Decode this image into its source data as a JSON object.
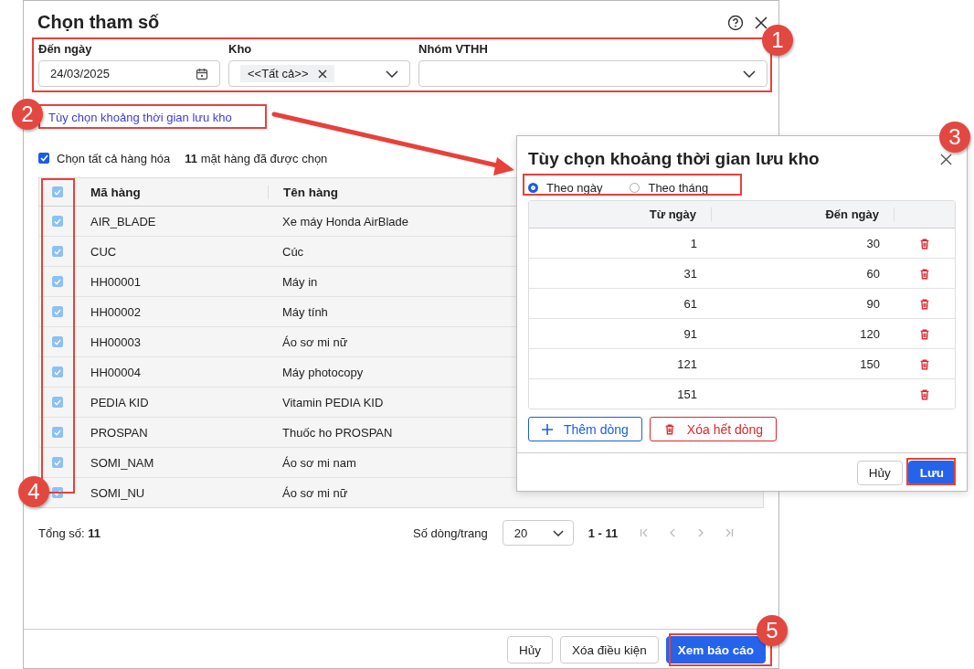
{
  "window": {
    "title": "Chọn tham số"
  },
  "filters": [
    {
      "kind": "date",
      "label": "Đến ngày",
      "value": "24/03/2025"
    },
    {
      "kind": "multiselect",
      "label": "Kho",
      "tag": "<<Tất cả>>"
    },
    {
      "kind": "select",
      "label": "Nhóm VTHH"
    }
  ],
  "range_link": "Tùy chọn khoảng thời gian lưu kho",
  "select_all": {
    "label": "Chọn tất cả hàng hóa",
    "checked": true,
    "summary": "**11** mặt hàng đã được chọn"
  },
  "table": {
    "header_checked": true,
    "columns": [
      "Mã hàng",
      "Tên hàng"
    ],
    "rows": [
      {
        "code": "AIR_BLADE",
        "name": "Xe máy Honda AirBlade",
        "checked": true
      },
      {
        "code": "CUC",
        "name": "Cúc",
        "checked": true
      },
      {
        "code": "HH00001",
        "name": "Máy in",
        "checked": true
      },
      {
        "code": "HH00002",
        "name": "Máy tính",
        "checked": true
      },
      {
        "code": "HH00003",
        "name": "Áo sơ mi nữ",
        "checked": true
      },
      {
        "code": "HH00004",
        "name": "Máy photocopy",
        "checked": true
      },
      {
        "code": "PEDIA KID",
        "name": "Vitamin PEDIA KID",
        "checked": true
      },
      {
        "code": "PROSPAN",
        "name": "Thuốc ho PROSPAN",
        "checked": true
      },
      {
        "code": "SOMI_NAM",
        "name": "Áo sơ mi nam",
        "checked": true
      },
      {
        "code": "SOMI_NU",
        "name": "Áo sơ mi nữ",
        "checked": true
      }
    ]
  },
  "pagination": {
    "total": "Tổng số: **11**",
    "rows_per_page_label": "Số dòng/trang",
    "rows_per_page": "20",
    "range": "1 - 11"
  },
  "footer_buttons": [
    {
      "label": "Hủy",
      "kind": "secondary"
    },
    {
      "label": "Xóa điều kiện",
      "kind": "secondary"
    },
    {
      "label": "Xem báo cáo",
      "kind": "primary"
    }
  ],
  "popup": {
    "title": "Tùy chọn khoảng thời gian lưu kho",
    "options": [
      {
        "label": "Theo ngày",
        "selected": true
      },
      {
        "label": "Theo tháng",
        "selected": false
      }
    ],
    "columns": [
      "Từ ngày",
      "Đến ngày"
    ],
    "rows": [
      {
        "from": "1",
        "to": "30"
      },
      {
        "from": "31",
        "to": "60"
      },
      {
        "from": "61",
        "to": "90"
      },
      {
        "from": "91",
        "to": "120"
      },
      {
        "from": "121",
        "to": "150"
      },
      {
        "from": "151"
      }
    ],
    "add_button": "Thêm dòng",
    "clear_button": "Xóa hết dòng",
    "buttons": [
      {
        "label": "Hủy",
        "kind": "secondary"
      },
      {
        "label": "Lưu",
        "kind": "primary"
      }
    ]
  },
  "annotations": [
    {
      "number": "1"
    },
    {
      "number": "2"
    },
    {
      "number": "3"
    },
    {
      "number": "4"
    },
    {
      "number": "5"
    }
  ]
}
